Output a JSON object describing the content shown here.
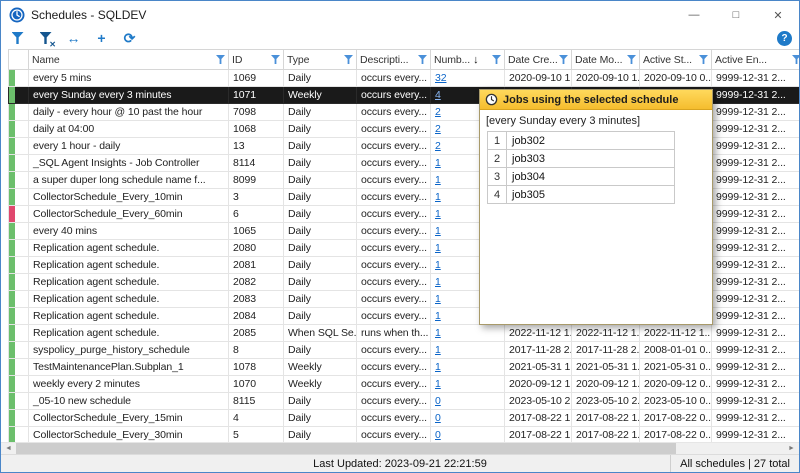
{
  "window": {
    "title": "Schedules - SQLDEV",
    "controls": {
      "minimize": "—",
      "maximize": "□",
      "close": "✕"
    }
  },
  "toolbar": {
    "fit_glyph": "↔",
    "add_glyph": "+",
    "refresh_glyph": "⟳",
    "help_glyph": "?"
  },
  "table": {
    "columns": [
      {
        "key": "indicator",
        "label": "",
        "filter": false
      },
      {
        "key": "name",
        "label": "Name",
        "filter": true
      },
      {
        "key": "id",
        "label": "ID",
        "filter": true
      },
      {
        "key": "type",
        "label": "Type",
        "filter": true
      },
      {
        "key": "desc",
        "label": "Descripti...",
        "filter": true
      },
      {
        "key": "jobs",
        "label": "Numb...",
        "filter": true,
        "sort": "desc"
      },
      {
        "key": "created",
        "label": "Date Cre...",
        "filter": true
      },
      {
        "key": "modified",
        "label": "Date Mo...",
        "filter": true
      },
      {
        "key": "start",
        "label": "Active St...",
        "filter": true
      },
      {
        "key": "end",
        "label": "Active En...",
        "filter": true
      }
    ],
    "rows": [
      {
        "indicator": "green",
        "name": "every 5 mins",
        "id": "1069",
        "type": "Daily",
        "description": "occurs every...",
        "jobs": "32",
        "created": "2020-09-10 1...",
        "modified": "2020-09-10 1...",
        "start": "2020-09-10 0...",
        "end": "9999-12-31 2...",
        "selected": false
      },
      {
        "indicator": "green",
        "name": "every Sunday every 3 minutes",
        "id": "1071",
        "type": "Weekly",
        "description": "occurs every...",
        "jobs": "4",
        "created": "",
        "modified": "",
        "start": "",
        "end": "9999-12-31 2...",
        "selected": true
      },
      {
        "indicator": "green",
        "name": "daily - every hour @ 10 past the hour",
        "id": "7098",
        "type": "Daily",
        "description": "occurs every...",
        "jobs": "2",
        "created": "",
        "modified": "",
        "start": "",
        "end": "9999-12-31 2...",
        "selected": false
      },
      {
        "indicator": "green",
        "name": "daily at 04:00",
        "id": "1068",
        "type": "Daily",
        "description": "occurs every...",
        "jobs": "2",
        "created": "",
        "modified": "",
        "start": "",
        "end": "9999-12-31 2...",
        "selected": false
      },
      {
        "indicator": "green",
        "name": "every 1 hour - daily",
        "id": "13",
        "type": "Daily",
        "description": "occurs every...",
        "jobs": "2",
        "created": "",
        "modified": "",
        "start": "",
        "end": "9999-12-31 2...",
        "selected": false
      },
      {
        "indicator": "green",
        "name": "_SQL Agent Insights - Job Controller",
        "id": "8114",
        "type": "Daily",
        "description": "occurs every...",
        "jobs": "1",
        "created": "",
        "modified": "",
        "start": "",
        "end": "9999-12-31 2...",
        "selected": false
      },
      {
        "indicator": "green",
        "name": "a super duper long schedule name f...",
        "id": "8099",
        "type": "Daily",
        "description": "occurs every...",
        "jobs": "1",
        "created": "",
        "modified": "",
        "start": "",
        "end": "9999-12-31 2...",
        "selected": false
      },
      {
        "indicator": "green",
        "name": "CollectorSchedule_Every_10min",
        "id": "3",
        "type": "Daily",
        "description": "occurs every...",
        "jobs": "1",
        "created": "",
        "modified": "",
        "start": "",
        "end": "9999-12-31 2...",
        "selected": false
      },
      {
        "indicator": "red",
        "name": "CollectorSchedule_Every_60min",
        "id": "6",
        "type": "Daily",
        "description": "occurs every...",
        "jobs": "1",
        "created": "",
        "modified": "",
        "start": "",
        "end": "9999-12-31 2...",
        "selected": false
      },
      {
        "indicator": "green",
        "name": "every 40 mins",
        "id": "1065",
        "type": "Daily",
        "description": "occurs every...",
        "jobs": "1",
        "created": "",
        "modified": "",
        "start": "",
        "end": "9999-12-31 2...",
        "selected": false
      },
      {
        "indicator": "green",
        "name": "Replication agent schedule.",
        "id": "2080",
        "type": "Daily",
        "description": "occurs every...",
        "jobs": "1",
        "created": "",
        "modified": "",
        "start": "",
        "end": "9999-12-31 2...",
        "selected": false
      },
      {
        "indicator": "green",
        "name": "Replication agent schedule.",
        "id": "2081",
        "type": "Daily",
        "description": "occurs every...",
        "jobs": "1",
        "created": "",
        "modified": "",
        "start": "",
        "end": "9999-12-31 2...",
        "selected": false
      },
      {
        "indicator": "green",
        "name": "Replication agent schedule.",
        "id": "2082",
        "type": "Daily",
        "description": "occurs every...",
        "jobs": "1",
        "created": "",
        "modified": "",
        "start": "",
        "end": "9999-12-31 2...",
        "selected": false
      },
      {
        "indicator": "green",
        "name": "Replication agent schedule.",
        "id": "2083",
        "type": "Daily",
        "description": "occurs every...",
        "jobs": "1",
        "created": "",
        "modified": "",
        "start": "",
        "end": "9999-12-31 2...",
        "selected": false
      },
      {
        "indicator": "green",
        "name": "Replication agent schedule.",
        "id": "2084",
        "type": "Daily",
        "description": "occurs every...",
        "jobs": "1",
        "created": "",
        "modified": "",
        "start": "",
        "end": "9999-12-31 2...",
        "selected": false
      },
      {
        "indicator": "green",
        "name": "Replication agent schedule.",
        "id": "2085",
        "type": "When SQL Se...",
        "description": "runs when th...",
        "jobs": "1",
        "created": "2022-11-12 1...",
        "modified": "2022-11-12 1...",
        "start": "2022-11-12 1...",
        "end": "9999-12-31 2...",
        "selected": false
      },
      {
        "indicator": "green",
        "name": "syspolicy_purge_history_schedule",
        "id": "8",
        "type": "Daily",
        "description": "occurs every...",
        "jobs": "1",
        "created": "2017-11-28 2...",
        "modified": "2017-11-28 2...",
        "start": "2008-01-01 0...",
        "end": "9999-12-31 2...",
        "selected": false
      },
      {
        "indicator": "green",
        "name": "TestMaintenancePlan.Subplan_1",
        "id": "1078",
        "type": "Weekly",
        "description": "occurs every...",
        "jobs": "1",
        "created": "2021-05-31 1...",
        "modified": "2021-05-31 1...",
        "start": "2021-05-31 0...",
        "end": "9999-12-31 2...",
        "selected": false
      },
      {
        "indicator": "green",
        "name": "weekly every 2 minutes",
        "id": "1070",
        "type": "Weekly",
        "description": "occurs every...",
        "jobs": "1",
        "created": "2020-09-12 1...",
        "modified": "2020-09-12 1...",
        "start": "2020-09-12 0...",
        "end": "9999-12-31 2...",
        "selected": false
      },
      {
        "indicator": "green",
        "name": "_05-10 new schedule",
        "id": "8115",
        "type": "Daily",
        "description": "occurs every...",
        "jobs": "0",
        "created": "2023-05-10 2...",
        "modified": "2023-05-10 2...",
        "start": "2023-05-10 0...",
        "end": "9999-12-31 2...",
        "selected": false
      },
      {
        "indicator": "green",
        "name": "CollectorSchedule_Every_15min",
        "id": "4",
        "type": "Daily",
        "description": "occurs every...",
        "jobs": "0",
        "created": "2017-08-22 1...",
        "modified": "2017-08-22 1...",
        "start": "2017-08-22 0...",
        "end": "9999-12-31 2...",
        "selected": false
      },
      {
        "indicator": "green",
        "name": "CollectorSchedule_Every_30min",
        "id": "5",
        "type": "Daily",
        "description": "occurs every...",
        "jobs": "0",
        "created": "2017-08-22 1...",
        "modified": "2017-08-22 1...",
        "start": "2017-08-22 0...",
        "end": "9999-12-31 2...",
        "selected": false
      }
    ]
  },
  "popup": {
    "title": "Jobs using the selected schedule",
    "schedule_name": "[every Sunday every 3 minutes]",
    "jobs": [
      {
        "num": "1",
        "name": "job302"
      },
      {
        "num": "2",
        "name": "job303"
      },
      {
        "num": "3",
        "name": "job304"
      },
      {
        "num": "4",
        "name": "job305"
      }
    ]
  },
  "statusbar": {
    "last_updated": "Last Updated: 2023-09-21 22:21:59",
    "summary": "All schedules | 27 total"
  },
  "colors": {
    "accent_blue": "#1f7ac8",
    "link": "#0a64c8",
    "selected_bg": "#1a1a1a",
    "popup_gold": "#f5bd2e",
    "ind_green": "#6cbf6c",
    "ind_red": "#e0486e"
  }
}
